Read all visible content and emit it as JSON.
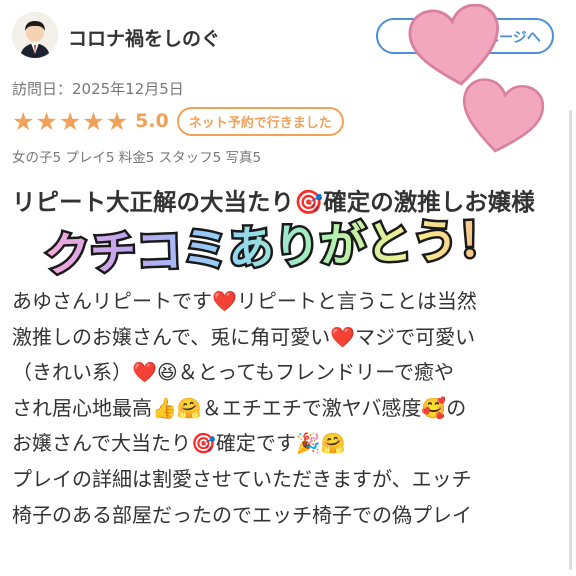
{
  "reviewer": {
    "name": "コロナ禍をしのぐ",
    "profile_button_label": "ユーザーページへ"
  },
  "visit": {
    "date_label": "訪問日：2025年12月5日"
  },
  "rating": {
    "stars": 5,
    "score": "5.0",
    "reservation_badge": "ネット予約で行きました"
  },
  "sub_ratings": "女の子5 プレイ5 料金5 スタッフ5 写真5",
  "review": {
    "title": "リピート大正解の大当たり🎯確定の激推しお嬢様",
    "body_lines": [
      "あゆさんリピートです❤️リピートと言うことは当然",
      "激推しのお嬢さんで、兎に角可愛い❤️マジで可愛い",
      "（きれい系）❤️😆＆とってもフレンドリーで癒や",
      "され居心地最高👍🤗＆エチエチで激ヤバ感度🥰の",
      "お嬢さんで大当たり🎯確定です🎉🤗",
      "プレイの詳細は割愛させていただきますが、エッチ",
      "椅子のある部屋だったのでエッチ椅子での偽プレイ"
    ]
  },
  "overlay": {
    "sticker_text": "クチコミありがとう！",
    "heart_color": "#f2a7bf"
  },
  "colors": {
    "accent_orange": "#f0a15a",
    "link_blue": "#4a8fd8",
    "text": "#333333",
    "muted": "#777777"
  }
}
